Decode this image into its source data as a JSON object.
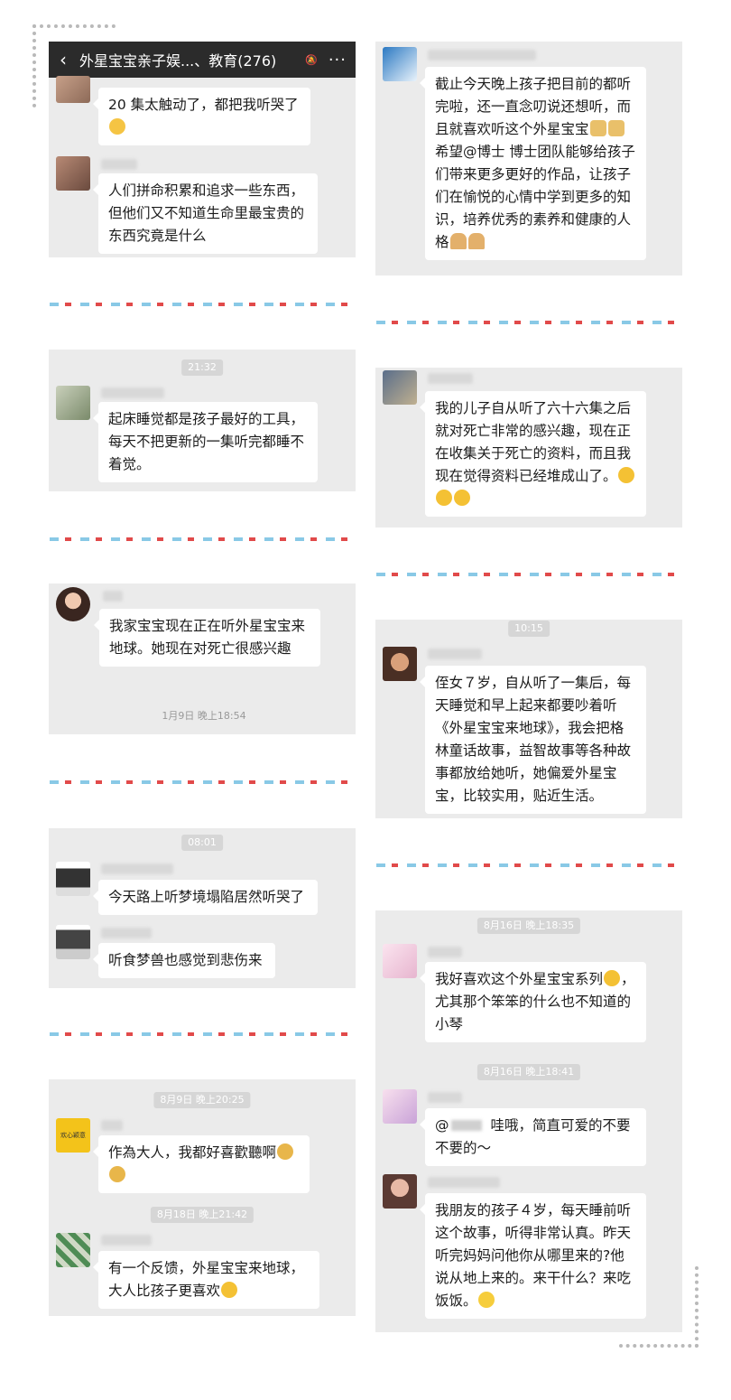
{
  "header": {
    "back_icon": "‹",
    "title": "外星宝宝亲子娱...、教育(276)",
    "mute_icon": "mute-bell-icon",
    "more_icon": "···"
  },
  "left": {
    "p1": {
      "m1": {
        "text": "20 集太触动了，都把我听哭了"
      },
      "m2": {
        "text": "人们拼命积累和追求一些东西，但他们又不知道生命里最宝贵的东西究竟是什么"
      }
    },
    "p2": {
      "ts": "21:32",
      "m1": {
        "text": "起床睡觉都是孩子最好的工具，每天不把更新的一集听完都睡不着觉。"
      }
    },
    "p3": {
      "m1": {
        "text": "我家宝宝现在正在听外星宝宝来地球。她现在对死亡很感兴趣"
      },
      "sent": "1月9日 晚上18:54"
    },
    "p4": {
      "ts": "08:01",
      "m1": {
        "text": "今天路上听梦境塌陷居然听哭了"
      },
      "m2": {
        "text": "听食梦兽也感觉到悲伤来"
      }
    },
    "p5": {
      "ts1": "8月9日 晚上20:25",
      "m1": {
        "text": "作為大人，我都好喜歡聽啊",
        "avatar_text": "欢心颖意"
      },
      "ts2": "8月18日 晚上21:42",
      "m2": {
        "text": "有一个反馈，外星宝宝来地球，大人比孩子更喜欢"
      }
    }
  },
  "right": {
    "p1": {
      "m1": {
        "text1": "截止今天晚上孩子把目前的都听完啦，还一直念叨说还想听，而且就喜欢听这个外星宝宝",
        "text2": "希望@博士  博士团队能够给孩子们带来更多更好的作品，让孩子们在愉悦的心情中学到更多的知识，培养优秀的素养和健康的人格"
      }
    },
    "p2": {
      "m1": {
        "text": "我的儿子自从听了六十六集之后就对死亡非常的感兴趣，现在正在收集关于死亡的资料，而且我现在觉得资料已经堆成山了。"
      }
    },
    "p3": {
      "ts": "10:15",
      "m1": {
        "text": "侄女７岁，自从听了一集后，每天睡觉和早上起来都要吵着听《外星宝宝来地球》，我会把格林童话故事，益智故事等各种故事都放给她听，她偏爱外星宝宝，比较实用，贴近生活。"
      }
    },
    "p4": {
      "ts1": "8月16日 晚上18:35",
      "m1": {
        "text": "我好喜欢这个外星宝宝系列",
        "text2": "，尤其那个笨笨的什么也不知道的小琴"
      },
      "ts2": "8月16日 晚上18:41",
      "m2": {
        "text_pre": "@",
        "text": "哇哦，简直可爱的不要不要的～"
      },
      "m3": {
        "text": "我朋友的孩子４岁，每天睡前听这个故事，听得非常认真。昨天听完妈妈问他你从哪里来的?他说从地上来的。来干什么？来吃饭饭。"
      }
    }
  },
  "colors": {
    "panel_bg": "#ebebeb",
    "header_bg": "#2b2b2b",
    "sep_blue": "#89c9e6",
    "sep_red": "#e14a4a"
  }
}
